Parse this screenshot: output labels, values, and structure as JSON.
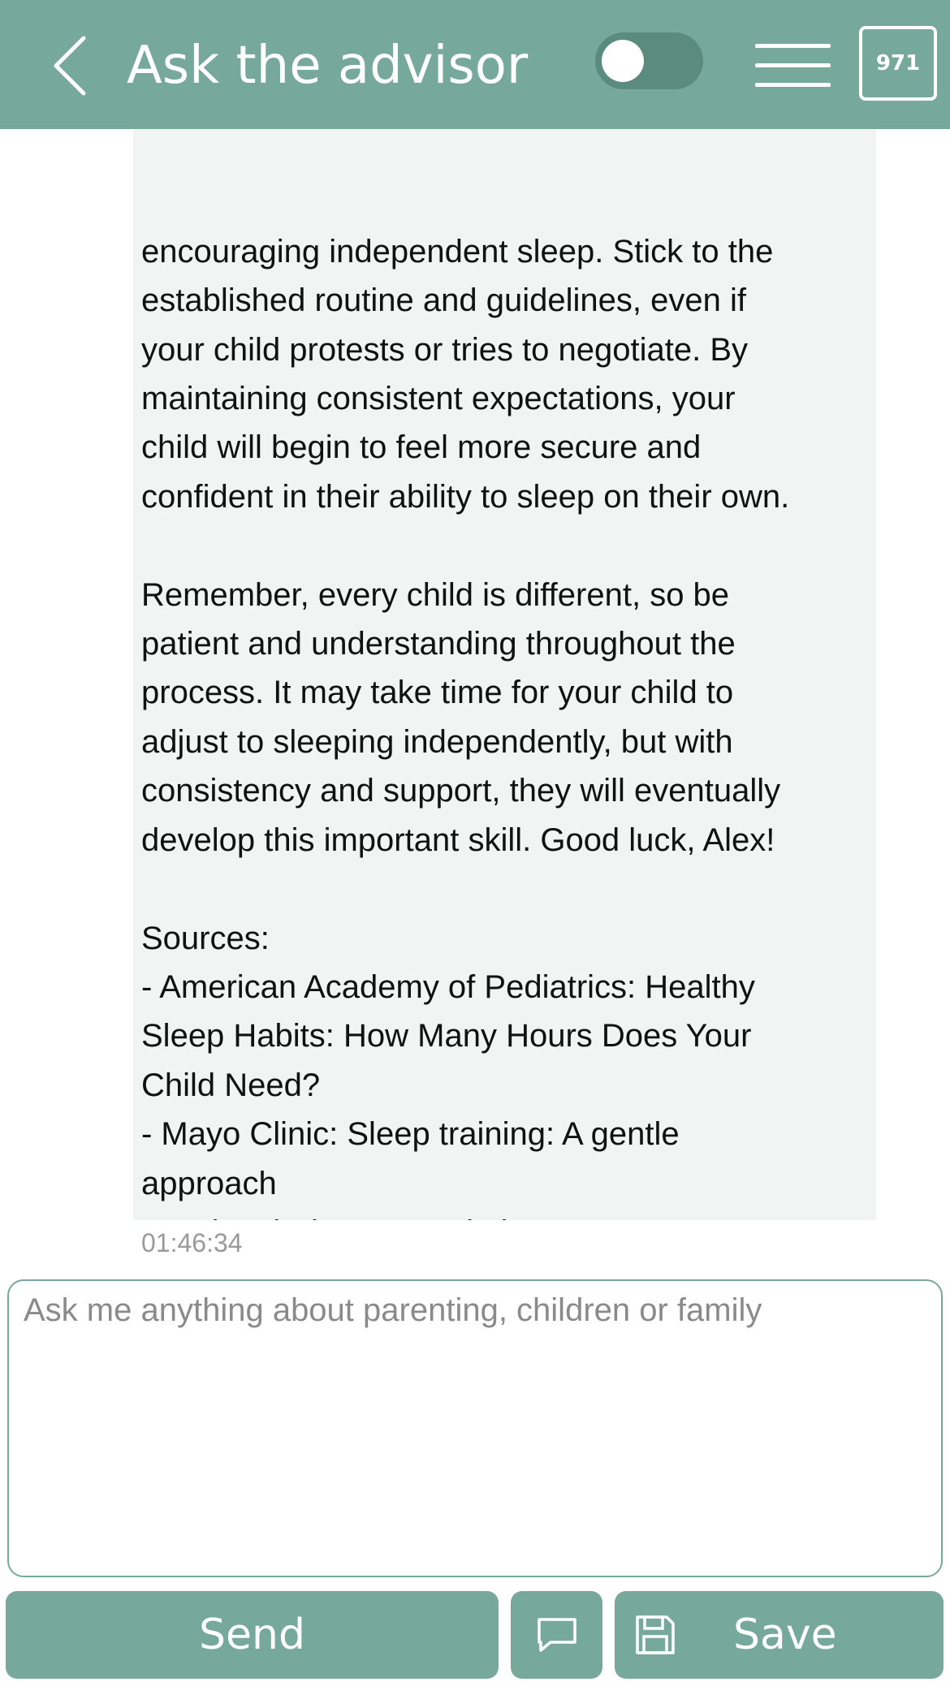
{
  "header": {
    "back_icon": "chevron-left-icon",
    "title": "Ask the advisor",
    "toggle_on": false,
    "menu_icon": "hamburger-menu-icon",
    "counter": "971",
    "color": "#76a99b"
  },
  "message": {
    "text": "encouraging independent sleep. Stick to the\nestablished routine and guidelines, even if\nyour child protests or tries to negotiate. By\nmaintaining consistent expectations, your\nchild will begin to feel more secure and\nconfident in their ability to sleep on their own.\n\nRemember, every child is different, so be\npatient and understanding throughout the\nprocess. It may take time for your child to\nadjust to sleeping independently, but with\nconsistency and support, they will eventually\ndevelop this important skill. Good luck, Alex!\n\nSources:\n- American Academy of Pediatrics: Healthy\nSleep Habits: How Many Hours Does Your\nChild Need?\n- Mayo Clinic: Sleep training: A gentle\napproach\n- National Sleep Foundation: How to Ease\nYour Child Into Sleeping Alone",
    "timestamp": "01:46:34",
    "background": "#f1f4f3"
  },
  "composer": {
    "placeholder": "Ask me anything about parenting, children or family",
    "value": ""
  },
  "actions": {
    "send_label": "Send",
    "chat_icon": "speech-bubble-icon",
    "save_icon": "floppy-disk-icon",
    "save_label": "Save"
  }
}
